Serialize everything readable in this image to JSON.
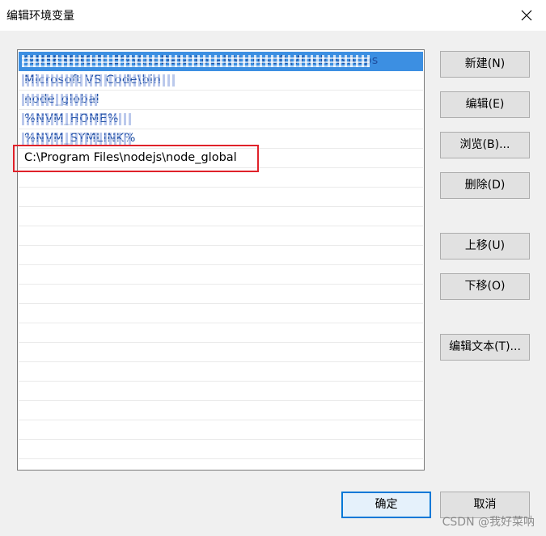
{
  "window": {
    "title": "编辑环境变量",
    "close_icon": "close-icon"
  },
  "path_list": {
    "items": [
      {
        "text": "%USERPROFILE%\\AppData\\Local\\Microsoft\\WindowsApps",
        "selected": true,
        "obscured": true
      },
      {
        "text": "Microsoft VS Code\\bin",
        "selected": false,
        "obscured": true
      },
      {
        "text": "node_global",
        "selected": false,
        "obscured": true
      },
      {
        "text": "%NVM_HOME%",
        "selected": false,
        "obscured": true
      },
      {
        "text": "%NVM_SYMLINK%",
        "selected": false,
        "obscured": true
      },
      {
        "text": "C:\\Program Files\\nodejs\\node_global",
        "selected": false,
        "obscured": false
      }
    ],
    "highlight_color": "#e0222a",
    "selection_color": "#3c8fe2"
  },
  "buttons": {
    "new": "新建(N)",
    "edit": "编辑(E)",
    "browse": "浏览(B)...",
    "delete": "删除(D)",
    "move_up": "上移(U)",
    "move_down": "下移(O)",
    "edit_text": "编辑文本(T)...",
    "ok": "确定",
    "cancel": "取消"
  },
  "watermark": "CSDN @我好菜呐"
}
